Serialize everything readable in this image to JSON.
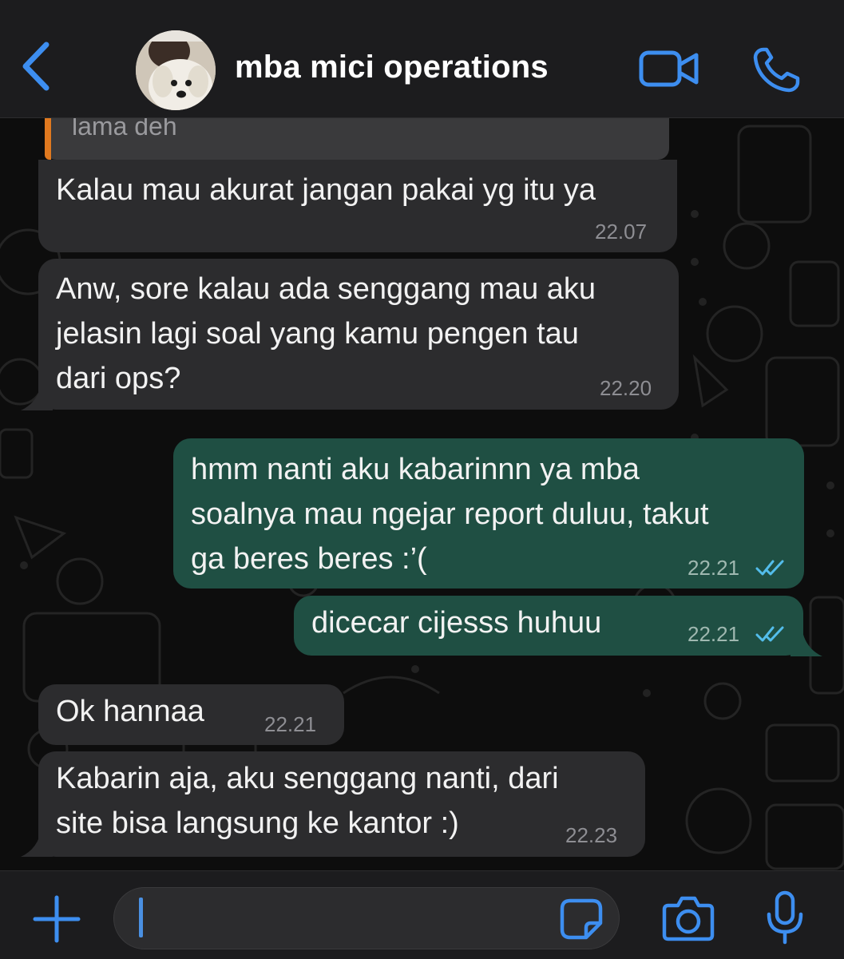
{
  "header": {
    "title": "mba mici operations",
    "back_icon": "chevron-left-icon",
    "video_icon": "video-camera-icon",
    "call_icon": "phone-icon",
    "accent_color": "#3d8ef0"
  },
  "quoted": {
    "text": "lama deh",
    "bar_color": "#e0791f"
  },
  "messages": [
    {
      "direction": "incoming",
      "text": "Kalau mau akurat jangan pakai yg itu ya",
      "time": "22.07"
    },
    {
      "direction": "incoming",
      "text": "Anw, sore kalau ada senggang mau aku\njelasin lagi soal yang kamu pengen tau\ndari ops?",
      "time": "22.20"
    },
    {
      "direction": "outgoing",
      "text": "hmm nanti aku kabarinnn ya mba\nsoalnya mau ngejar report duluu, takut\nga beres beres :’(",
      "time": "22.21",
      "status": "read"
    },
    {
      "direction": "outgoing",
      "text": "dicecar cijesss huhuu",
      "time": "22.21",
      "status": "read"
    },
    {
      "direction": "incoming",
      "text": "Ok hannaa",
      "time": "22.21"
    },
    {
      "direction": "incoming",
      "text": "Kabarin aja, aku senggang nanti, dari\nsite bisa langsung ke kantor :)",
      "time": "22.23"
    }
  ],
  "composer": {
    "plus_icon": "plus-icon",
    "sticker_icon": "sticker-icon",
    "camera_icon": "camera-icon",
    "mic_icon": "microphone-icon"
  },
  "colors": {
    "incoming_bubble": "#2c2c2e",
    "outgoing_bubble": "#1f4f43",
    "read_ticks": "#53bdeb"
  }
}
